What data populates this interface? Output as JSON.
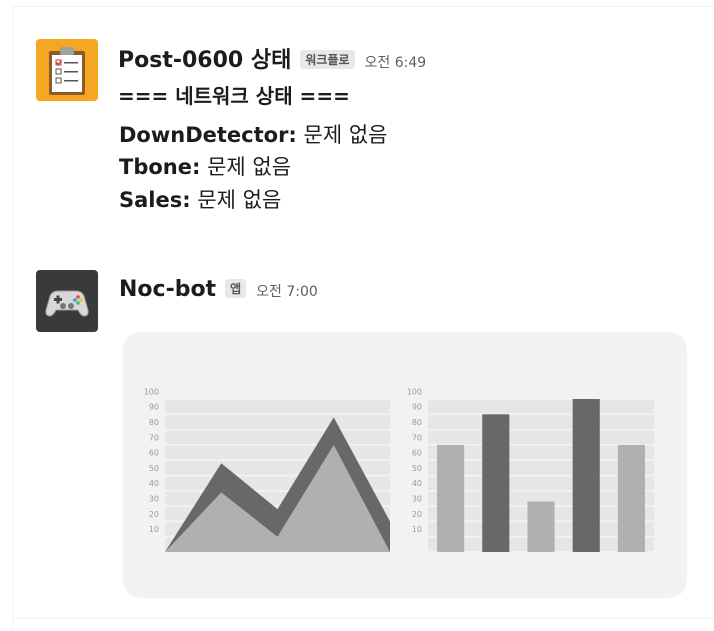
{
  "messages": [
    {
      "sender": "Post-0600 상태",
      "badge": "워크플로",
      "time": "오전 6:49",
      "avatar_icon": "clipboard-icon",
      "heading": "=== 네트워크 상태 ===",
      "statuses": [
        {
          "name": "DownDetector:",
          "value": "문제 없음"
        },
        {
          "name": "Tbone:",
          "value": "문제 없음"
        },
        {
          "name": "Sales:",
          "value": "문제 없음"
        }
      ]
    },
    {
      "sender": "Noc-bot",
      "badge": "앱",
      "time": "오전 7:00",
      "avatar_icon": "gamepad-icon"
    }
  ],
  "colors": {
    "dark_series": "#686868",
    "light_series": "#b0b0b0",
    "card_bg": "#f2f2f2",
    "clipboard_avatar_bg": "#f5a623",
    "gamepad_avatar_bg": "#3a3a3a"
  },
  "chart_data": [
    {
      "type": "area",
      "ylim": [
        0,
        100
      ],
      "yticks": [
        "10",
        "20",
        "30",
        "40",
        "50",
        "60",
        "70",
        "80",
        "90",
        "100"
      ],
      "series": [
        {
          "color": "#686868",
          "values": [
            0,
            58,
            28,
            88,
            20
          ]
        },
        {
          "color": "#b0b0b0",
          "values": [
            0,
            39,
            10,
            70,
            0
          ]
        }
      ]
    },
    {
      "type": "bar",
      "ylim": [
        0,
        100
      ],
      "yticks": [
        "10",
        "20",
        "30",
        "40",
        "50",
        "60",
        "70",
        "80",
        "90",
        "100"
      ],
      "values": [
        70,
        90,
        33,
        100,
        70
      ],
      "colors": [
        "#b0b0b0",
        "#686868",
        "#b0b0b0",
        "#686868",
        "#b0b0b0"
      ]
    }
  ]
}
